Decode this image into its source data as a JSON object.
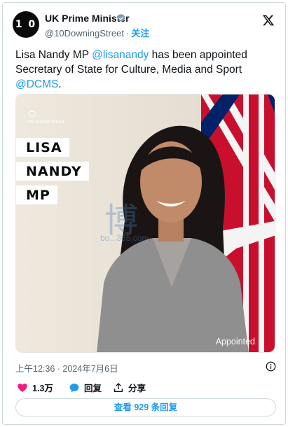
{
  "tweet": {
    "author": {
      "display_name": "UK Prime Minister",
      "handle": "@10DowningStreet",
      "avatar_text": "1 0",
      "follow_label": "关注",
      "verified": true
    },
    "text": {
      "part1": "Lisa Nandy MP ",
      "mention1": "@lisanandy",
      "part2": " has been appointed Secretary of State for Culture, Media and Sport ",
      "mention2": "@DCMS",
      "part3": "."
    },
    "media": {
      "gov_label": "UK Government",
      "name_lines": [
        "LISA",
        "NANDY",
        "MP"
      ],
      "caption": "Appointed",
      "watermark": "博",
      "watermark_sub": "bo...365.com"
    },
    "timestamp": "上午12:36 · 2024年7月6日",
    "actions": {
      "like_count": "1.3万",
      "reply_label": "回复",
      "share_label": "分享"
    },
    "view_replies_label": "查看 929 条回复"
  },
  "colors": {
    "accent": "#1d9bf0",
    "like": "#f91880",
    "text": "#0f1419",
    "muted": "#536471"
  }
}
